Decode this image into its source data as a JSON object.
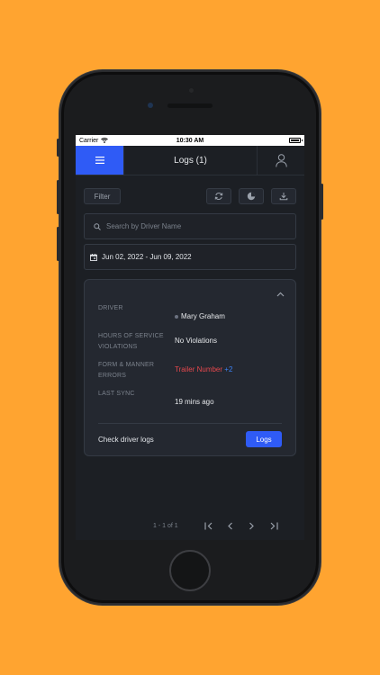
{
  "status_bar": {
    "carrier": "Carrier",
    "time": "10:30 AM"
  },
  "app_bar": {
    "title": "Logs (1)"
  },
  "toolbar": {
    "filter_label": "Filter"
  },
  "search": {
    "placeholder": "Search by Driver Name",
    "value": ""
  },
  "date_range": {
    "label": "Jun 02, 2022 - Jun 09, 2022"
  },
  "card": {
    "driver_label": "DRIVER",
    "driver_name": "Mary Graham",
    "hos_label_line1": "HOURS OF SERVICE",
    "hos_label_line2": "VIOLATIONS",
    "hos_value": "No Violations",
    "form_label_line1": "FORM & MANNER",
    "form_label_line2": "ERRORS",
    "form_error": "Trailer Number",
    "form_more": "+2",
    "sync_label": "LAST SYNC",
    "sync_value": "19 mins ago",
    "footer_text": "Check driver logs",
    "logs_button": "Logs"
  },
  "pagination": {
    "info": "1 - 1 of 1"
  },
  "colors": {
    "background": "#FFA430",
    "accent": "#2F5BF6",
    "error": "#E5484D",
    "link": "#3B82F6"
  }
}
